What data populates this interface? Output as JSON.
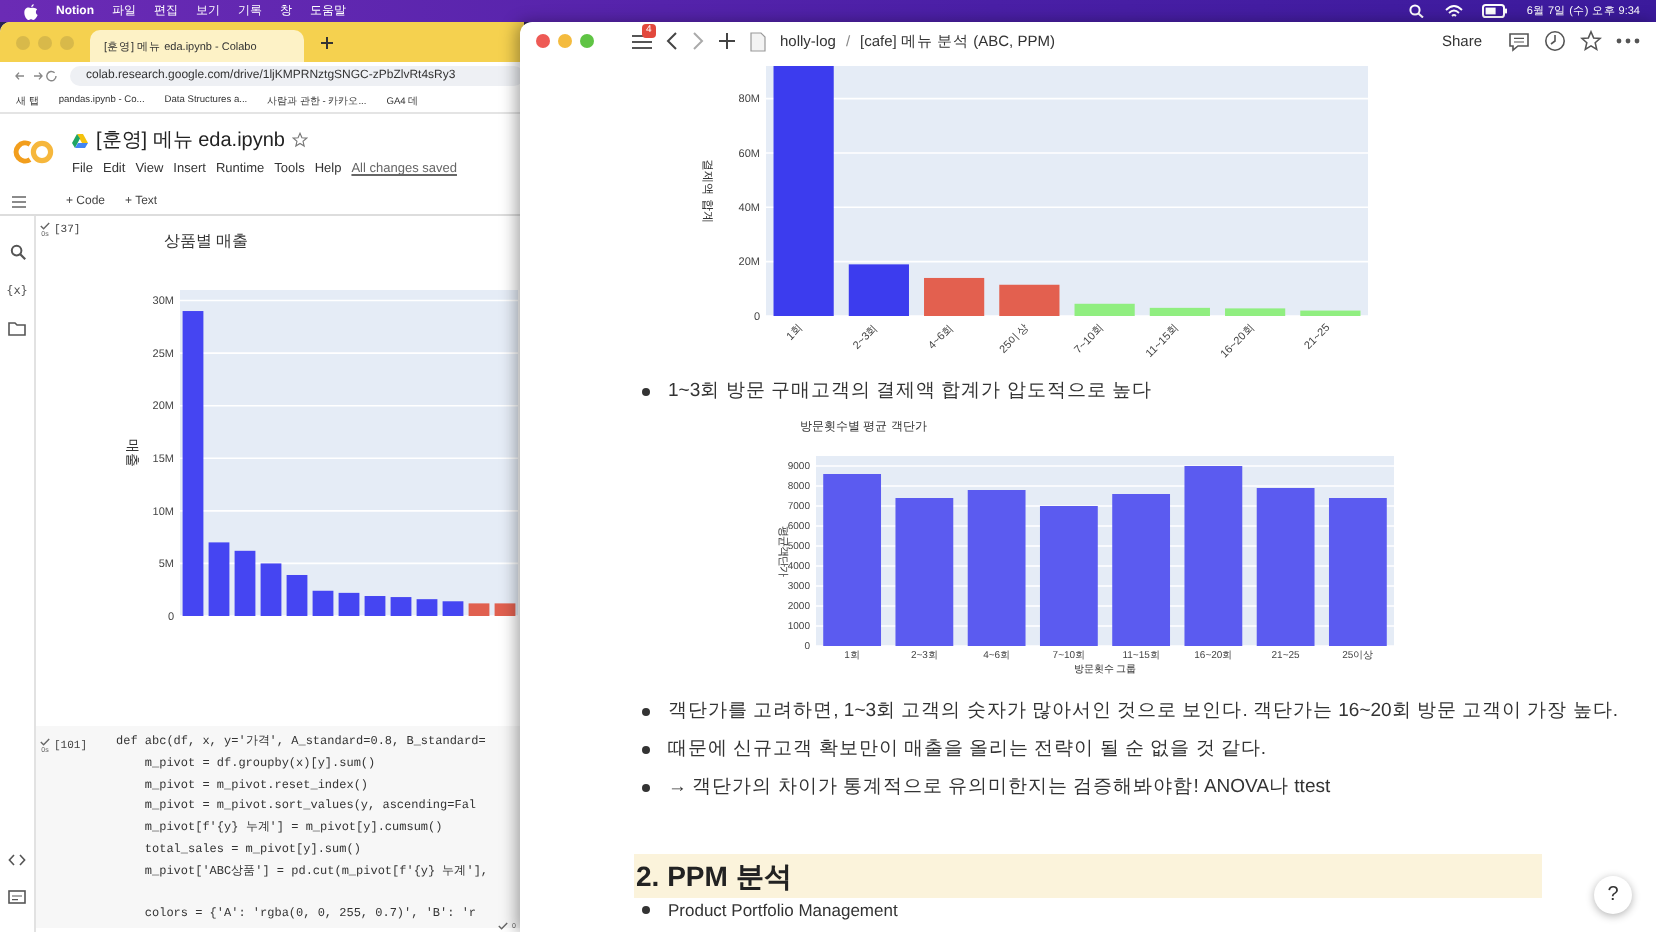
{
  "menu_bar": {
    "app": "Notion",
    "items": [
      "파일",
      "편집",
      "보기",
      "기록",
      "창",
      "도움말"
    ],
    "clock": "6월 7일 (수) 오후 9:34"
  },
  "colab_window": {
    "tab_title": "[훈영] 메뉴 eda.ipynb - Colabo",
    "url": "colab.research.google.com/drive/1ljKMPRNztgSNGC-zPbZlvRt4sRy3",
    "bookmarks": [
      "새 탭",
      "pandas.ipynb - Co...",
      "Data Structures a...",
      "사람과 관한 - 카카오...",
      "GA4 데"
    ],
    "notebook_title": "[훈영] 메뉴 eda.ipynb",
    "menu": [
      "File",
      "Edit",
      "View",
      "Insert",
      "Runtime",
      "Tools",
      "Help"
    ],
    "save_status": "All changes saved",
    "toolbar": [
      "+ Code",
      "+ Text"
    ],
    "variables_label": "{x}",
    "cells": [
      {
        "kind": "output",
        "count": "[37]",
        "time": "0s",
        "chart_data": {
          "type": "bar",
          "title": "상품별 매출",
          "ylabel": "매출",
          "ylim": [
            0,
            31000000
          ],
          "yticks": [
            {
              "value": 0,
              "label": "0"
            },
            {
              "value": 5000000,
              "label": "5M"
            },
            {
              "value": 10000000,
              "label": "10M"
            },
            {
              "value": 15000000,
              "label": "15M"
            },
            {
              "value": 20000000,
              "label": "20M"
            },
            {
              "value": 25000000,
              "label": "25M"
            },
            {
              "value": 30000000,
              "label": "30M"
            }
          ],
          "series": [
            {
              "color": "#4545f2",
              "values": [
                29000000,
                7000000,
                6200000,
                5000000,
                3900000,
                2400000,
                2200000,
                1900000,
                1800000,
                1600000,
                1400000,
                null,
                null
              ]
            },
            {
              "color": "#e0604f",
              "values": [
                null,
                null,
                null,
                null,
                null,
                null,
                null,
                null,
                null,
                null,
                null,
                1200000,
                1200000
              ]
            }
          ],
          "grid": true
        }
      },
      {
        "kind": "code",
        "count": "[101]",
        "time": "0s",
        "code": [
          [
            "def abc(df, x, y='가격', A_standard=0.8, B_standard=",
            "    m_pivot = df.groupby(x)[y].sum()",
            "    m_pivot = m_pivot.reset_index()",
            "    m_pivot = m_pivot.sort_values(y, ascending=Fal",
            "    m_pivot[f'{y} 누계'] = m_pivot[y].cumsum()",
            "    total_sales = m_pivot[y].sum()",
            "    m_pivot['ABC상품'] = pd.cut(m_pivot[f'{y} 누계'],"
          ],
          [
            "    colors = {'A': 'rgba(0, 0, 255, 0.7)', 'B': 'r"
          ]
        ]
      }
    ],
    "status_time": "0"
  },
  "notion_window": {
    "notification_count": "4",
    "breadcrumb": [
      "holly-log",
      "[cafe] 메뉴 분석 (ABC, PPM)"
    ],
    "breadcrumb_separator": "/",
    "share": "Share",
    "help": "?",
    "blocks": [
      {
        "kind": "chart",
        "chart_data": {
          "type": "bar",
          "ylabel": "결제액 합계",
          "ylim": [
            0,
            92000000
          ],
          "categories": [
            "1회",
            "2~3회",
            "4~6회",
            "25이상",
            "7~10회",
            "11~15회",
            "16~20회",
            "21~25"
          ],
          "yticks": [
            {
              "value": 0,
              "label": "0"
            },
            {
              "value": 20000000,
              "label": "20M"
            },
            {
              "value": 40000000,
              "label": "40M"
            },
            {
              "value": 60000000,
              "label": "60M"
            },
            {
              "value": 80000000,
              "label": "80M"
            }
          ],
          "series": [
            {
              "color": "#3c3cee",
              "values": [
                92000000,
                19000000,
                null,
                null,
                null,
                null,
                null,
                null
              ]
            },
            {
              "color": "#e3604f",
              "values": [
                null,
                null,
                14000000,
                11500000,
                null,
                null,
                null,
                null
              ]
            },
            {
              "color": "#90ee80",
              "values": [
                null,
                null,
                null,
                null,
                4500000,
                3000000,
                2800000,
                2000000
              ]
            }
          ],
          "grid": true
        }
      },
      {
        "kind": "bullet",
        "text": "1~3회 방문 구매고객의 결제액 합계가 압도적으로 높다"
      },
      {
        "kind": "chart",
        "chart_data": {
          "type": "bar",
          "title": "방문횟수별 평균 객단가",
          "xlabel": "방문횟수 그룹",
          "ylabel": "평균객단가",
          "ylim": [
            0,
            9500
          ],
          "categories": [
            "1회",
            "2~3회",
            "4~6회",
            "7~10회",
            "11~15회",
            "16~20회",
            "21~25",
            "25이상"
          ],
          "yticks": [
            0,
            1000,
            2000,
            3000,
            4000,
            5000,
            6000,
            7000,
            8000,
            9000
          ],
          "series": [
            {
              "color": "#5b5bf0",
              "values": [
                8600,
                7400,
                7800,
                7000,
                7600,
                9000,
                7900,
                7400
              ]
            }
          ],
          "grid": true
        }
      },
      {
        "kind": "bullet",
        "text": "객단가를 고려하면, 1~3회 고객의 숫자가 많아서인 것으로 보인다. 객단가는 16~20회 방문 고객이 가장 높다."
      },
      {
        "kind": "bullet",
        "text": "때문에 신규고객 확보만이 매출을 올리는 전략이 될 순 없을 것 같다."
      },
      {
        "kind": "bullet",
        "text": "→ 객단가의 차이가 통계적으로 유의미한지는 검증해봐야함! ANOVA나 ttest"
      },
      {
        "kind": "heading",
        "text": "2. PPM 분석"
      },
      {
        "kind": "bullet",
        "text": "Product Portfolio Management"
      }
    ]
  }
}
